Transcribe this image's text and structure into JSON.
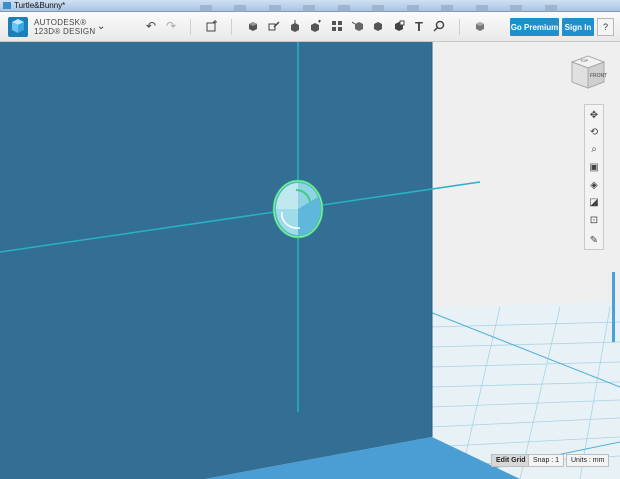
{
  "window": {
    "title": "Turtle&Bunny*"
  },
  "brand": {
    "line1": "AUTODESK®",
    "line2": "123D® DESIGN"
  },
  "icons": {
    "menu_caret": "chevron-down-icon",
    "undo": "undo-icon",
    "redo": "redo-icon",
    "add_primitive": "add-primitive-icon",
    "primitives": "primitives-icon",
    "sketch": "sketch-icon",
    "construct": "construct-icon",
    "modify": "modify-icon",
    "pattern": "pattern-icon",
    "group": "group-icon",
    "combine": "combine-icon",
    "measure": "measure-icon",
    "text": "text-icon",
    "snap": "snap-icon",
    "materials": "materials-icon"
  },
  "header": {
    "go_premium": "Go Premium",
    "sign_in": "Sign In",
    "help": "?"
  },
  "viewcube": {
    "top": "TOP",
    "front": "FRONT"
  },
  "navbar": {
    "items": [
      "pan-icon",
      "orbit-icon",
      "zoom-icon",
      "fit-icon",
      "view-mode-icon",
      "perspective-icon",
      "hide-show-icon",
      "materials-outline-icon"
    ]
  },
  "status": {
    "edit_grid": "Edit Grid",
    "snap": "Snap : 1",
    "units": "Units : mm"
  },
  "colors": {
    "accent": "#1e8fd0",
    "plane": "#336e94",
    "axis": "#26b3c4",
    "grid": "#cfe6f0",
    "gizmo": "#39d27d"
  }
}
